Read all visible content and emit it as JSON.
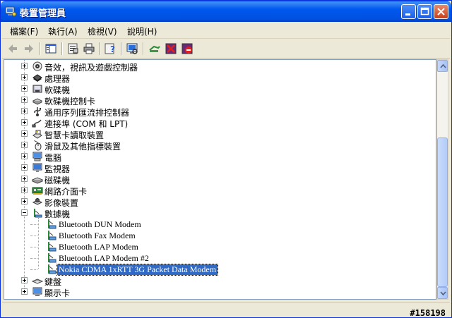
{
  "window": {
    "title": "裝置管理員",
    "icon": "device-manager-icon"
  },
  "menubar": {
    "items": [
      "檔案(F)",
      "執行(A)",
      "檢視(V)",
      "說明(H)"
    ]
  },
  "toolbar": {
    "icons": [
      "back-arrow-icon",
      "forward-arrow-icon",
      "show-hide-console-tree-icon",
      "properties-icon",
      "print-icon",
      "help-icon",
      "scan-hardware-icon",
      "update-driver-icon",
      "uninstall-icon",
      "disable-icon"
    ]
  },
  "tree": {
    "categories": [
      {
        "label": "音效，視訊及遊戲控制器",
        "icon": "sound-icon",
        "expanded": false
      },
      {
        "label": "處理器",
        "icon": "processor-icon",
        "expanded": false
      },
      {
        "label": "軟碟機",
        "icon": "floppy-drive-icon",
        "expanded": false
      },
      {
        "label": "軟碟機控制卡",
        "icon": "floppy-controller-icon",
        "expanded": false
      },
      {
        "label": "通用序列匯流排控制器",
        "icon": "usb-icon",
        "expanded": false
      },
      {
        "label": "連接埠 (COM 和 LPT)",
        "icon": "port-icon",
        "expanded": false
      },
      {
        "label": "智慧卡讀取裝置",
        "icon": "smart-card-icon",
        "expanded": false
      },
      {
        "label": "滑鼠及其他指標裝置",
        "icon": "mouse-icon",
        "expanded": false
      },
      {
        "label": "電腦",
        "icon": "computer-icon",
        "expanded": false
      },
      {
        "label": "監視器",
        "icon": "monitor-icon",
        "expanded": false
      },
      {
        "label": "磁碟機",
        "icon": "disk-drive-icon",
        "expanded": false
      },
      {
        "label": "網路介面卡",
        "icon": "network-adapter-icon",
        "expanded": false
      },
      {
        "label": "影像裝置",
        "icon": "imaging-icon",
        "expanded": false
      },
      {
        "label": "數據機",
        "icon": "modem-icon",
        "expanded": true
      }
    ],
    "modems": [
      {
        "label": "Bluetooth DUN Modem",
        "selected": false
      },
      {
        "label": "Bluetooth Fax Modem",
        "selected": false
      },
      {
        "label": "Bluetooth LAP Modem",
        "selected": false
      },
      {
        "label": "Bluetooth LAP Modem #2",
        "selected": false
      },
      {
        "label": "Nokia CDMA 1xRTT 3G Packet Data Modem",
        "selected": true
      }
    ],
    "after": [
      {
        "label": "鍵盤",
        "icon": "keyboard-icon",
        "expanded": false
      },
      {
        "label": "顯示卡",
        "icon": "display-adapter-icon",
        "expanded": false
      }
    ]
  },
  "status": {
    "watermark": "#158198"
  },
  "colors": {
    "titlebar": "#0058ee",
    "selection": "#316ac5",
    "chrome": "#ece9d8"
  }
}
